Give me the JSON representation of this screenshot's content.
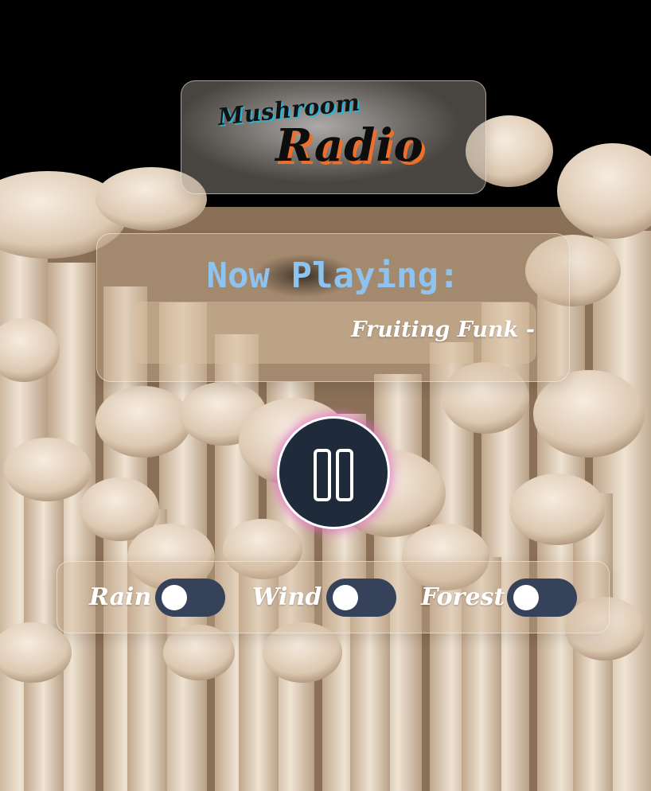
{
  "logo": {
    "line1": "Mushroom",
    "line2": "Radio"
  },
  "now_playing": {
    "heading": "Now Playing:",
    "track": "Fruiting Funk -"
  },
  "player": {
    "state": "playing",
    "button_icon": "pause-icon"
  },
  "ambient": {
    "sounds": [
      {
        "label": "Rain",
        "enabled": false
      },
      {
        "label": "Wind",
        "enabled": false
      },
      {
        "label": "Forest",
        "enabled": false
      }
    ]
  },
  "colors": {
    "heading": "#8ec3f0",
    "button_bg": "#1f2a3b",
    "button_glow": "#e46ec8",
    "toggle_track": "#36425a",
    "logo_accent_blue": "#26b5d6",
    "logo_accent_orange": "#ee6f2b"
  }
}
